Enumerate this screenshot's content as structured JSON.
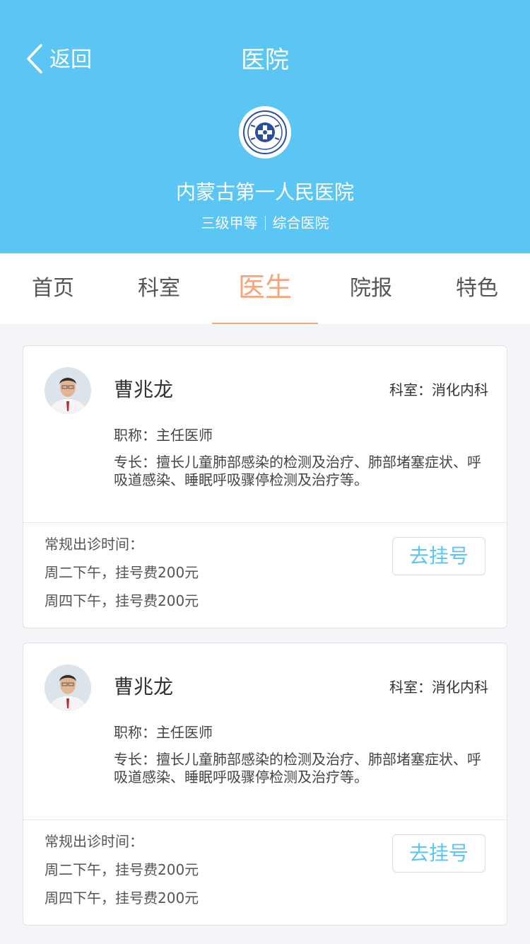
{
  "header": {
    "back_label": "返回",
    "title": "医院",
    "hospital_name": "内蒙古第一人民医院",
    "tags": [
      "三级甲等",
      "综合医院"
    ]
  },
  "tabs": [
    {
      "label": "首页"
    },
    {
      "label": "科室"
    },
    {
      "label": "医生",
      "active": true
    },
    {
      "label": "院报"
    },
    {
      "label": "特色"
    }
  ],
  "doctors": [
    {
      "name": "曹兆龙",
      "department": "科室：消化内科",
      "title": "职称：主任医师",
      "specialty": "专长：擅长儿童肺部感染的检测及治疗、肺部堵塞症状、呼吸道感染、睡眠呼吸骤停检测及治疗等。",
      "schedule_header": "常规出诊时间：",
      "schedule": [
        "周二下午，挂号费200元",
        "周四下午，挂号费200元"
      ],
      "register_label": "去挂号"
    },
    {
      "name": "曹兆龙",
      "department": "科室：消化内科",
      "title": "职称：主任医师",
      "specialty": "专长：擅长儿童肺部感染的检测及治疗、肺部堵塞症状、呼吸道感染、睡眠呼吸骤停检测及治疗等。",
      "schedule_header": "常规出诊时间：",
      "schedule": [
        "周二下午，挂号费200元",
        "周四下午，挂号费200元"
      ],
      "register_label": "去挂号"
    }
  ],
  "colors": {
    "header_bg": "#5bc6f4",
    "accent_active_tab": "#f5a57c",
    "register_text": "#5bc6f4",
    "page_bg": "#f4f5f9"
  },
  "icons": {
    "back": "chevron-left-icon",
    "logo": "hospital-logo",
    "avatar": "doctor-avatar"
  }
}
